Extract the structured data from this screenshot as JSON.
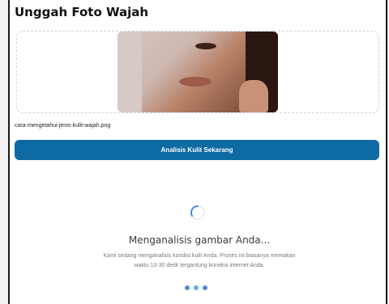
{
  "header": {
    "title": "Unggah Foto Wajah"
  },
  "upload": {
    "file_name": "cara-mengetahui-jenis-kulit-wajah.png"
  },
  "actions": {
    "analyze_label": "Analisis Kulit Sekarang"
  },
  "loading": {
    "title": "Menganalisis gambar Anda...",
    "description": "Kami sedang menganalisis kondisi kulit Anda. Proses ini biasanya memakan waktu 10-30 detik tergantung koneksi internet Anda."
  },
  "colors": {
    "primary": "#0e6aa3",
    "dots": "#4a90d9"
  },
  "icons": {
    "spinner": "loading-spinner-icon",
    "dots": "loading-dots-icon"
  }
}
